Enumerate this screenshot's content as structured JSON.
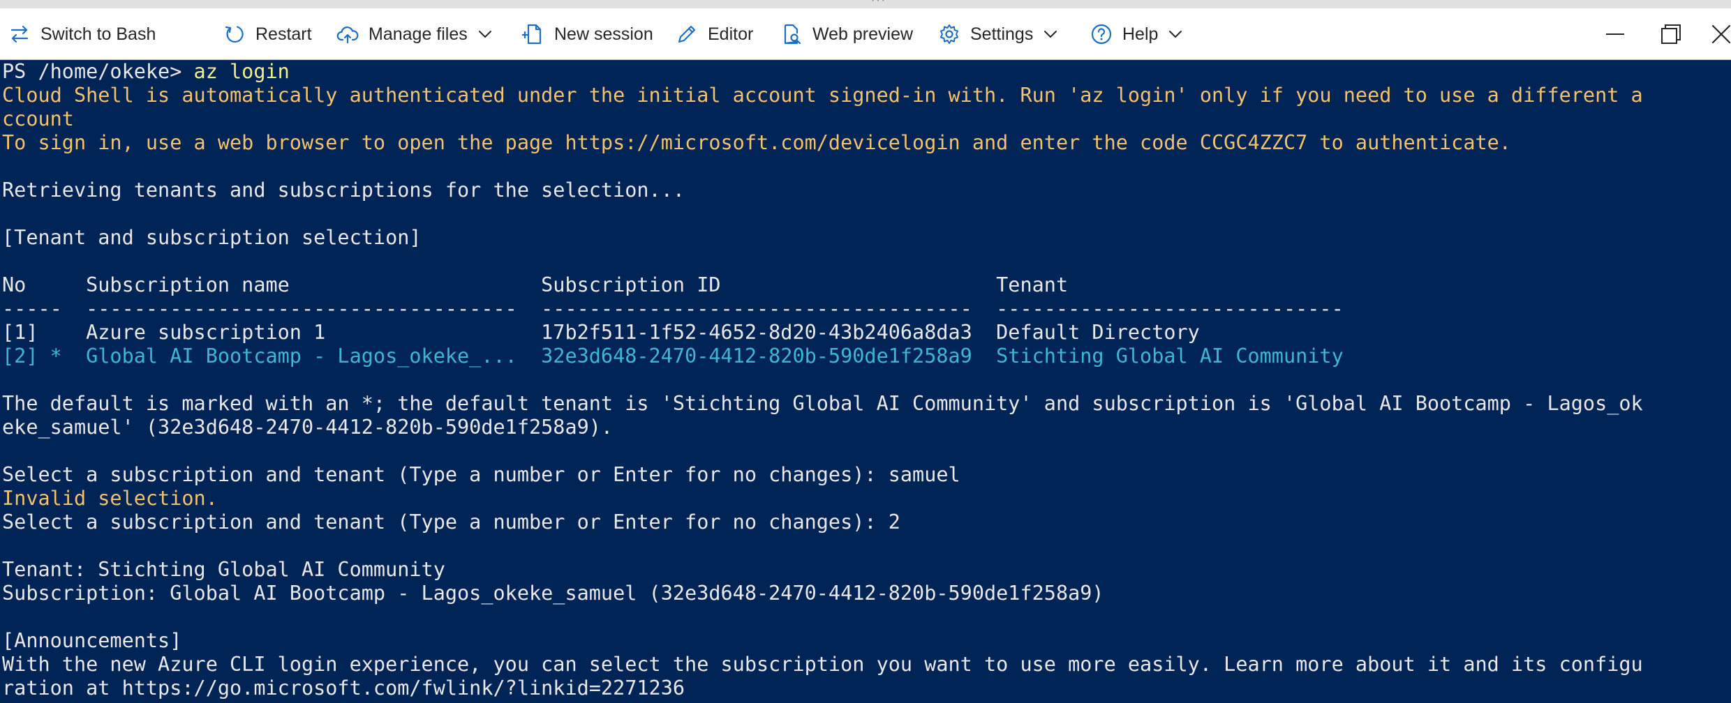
{
  "toolbar": {
    "switch_shell": "Switch to Bash",
    "restart": "Restart",
    "manage_files": "Manage files",
    "new_session": "New session",
    "editor": "Editor",
    "web_preview": "Web preview",
    "settings": "Settings",
    "help": "Help"
  },
  "terminal": {
    "prompt": "PS /home/okeke> ",
    "command": "az login",
    "lines": [
      {
        "text": "Cloud Shell is automatically authenticated under the initial account signed-in with. Run 'az login' only if you need to use a different a",
        "color": "yellow"
      },
      {
        "text": "ccount",
        "color": "yellow"
      },
      {
        "text": "To sign in, use a web browser to open the page https://microsoft.com/devicelogin and enter the code CCGC4ZZC7 to authenticate.",
        "color": "yellow"
      },
      {
        "text": "",
        "color": "white"
      },
      {
        "text": "Retrieving tenants and subscriptions for the selection...",
        "color": "white"
      },
      {
        "text": "",
        "color": "white"
      },
      {
        "text": "[Tenant and subscription selection]",
        "color": "white"
      },
      {
        "text": "",
        "color": "white"
      },
      {
        "text": "No     Subscription name                     Subscription ID                       Tenant",
        "color": "white"
      },
      {
        "text": "-----  ------------------------------------  ------------------------------------  -----------------------------",
        "color": "white"
      },
      {
        "text": "[1]    Azure subscription 1                  17b2f511-1f52-4652-8d20-43b2406a8da3  Default Directory",
        "color": "white"
      },
      {
        "text": "[2] *  Global AI Bootcamp - Lagos_okeke_...  32e3d648-2470-4412-820b-590de1f258a9  Stichting Global AI Community",
        "color": "cyan"
      },
      {
        "text": "",
        "color": "white"
      },
      {
        "text": "The default is marked with an *; the default tenant is 'Stichting Global AI Community' and subscription is 'Global AI Bootcamp - Lagos_ok",
        "color": "white"
      },
      {
        "text": "eke_samuel' (32e3d648-2470-4412-820b-590de1f258a9).",
        "color": "white"
      },
      {
        "text": "",
        "color": "white"
      },
      {
        "text": "Select a subscription and tenant (Type a number or Enter for no changes): samuel",
        "color": "white"
      },
      {
        "text": "Invalid selection.",
        "color": "yellow"
      },
      {
        "text": "Select a subscription and tenant (Type a number or Enter for no changes): 2",
        "color": "white"
      },
      {
        "text": "",
        "color": "white"
      },
      {
        "text": "Tenant: Stichting Global AI Community",
        "color": "white"
      },
      {
        "text": "Subscription: Global AI Bootcamp - Lagos_okeke_samuel (32e3d648-2470-4412-820b-590de1f258a9)",
        "color": "white"
      },
      {
        "text": "",
        "color": "white"
      },
      {
        "text": "[Announcements]",
        "color": "white"
      },
      {
        "text": "With the new Azure CLI login experience, you can select the subscription you want to use more easily. Learn more about it and its configu",
        "color": "white"
      },
      {
        "text": "ration at https://go.microsoft.com/fwlink/?linkid=2271236",
        "color": "white"
      }
    ]
  },
  "colors": {
    "background": "#012456",
    "white": "#e8e8e8",
    "yellow": "#f3c26c",
    "cyan": "#3fb6d3",
    "command": "#f2f08a",
    "icon_blue": "#1a6fc4"
  }
}
